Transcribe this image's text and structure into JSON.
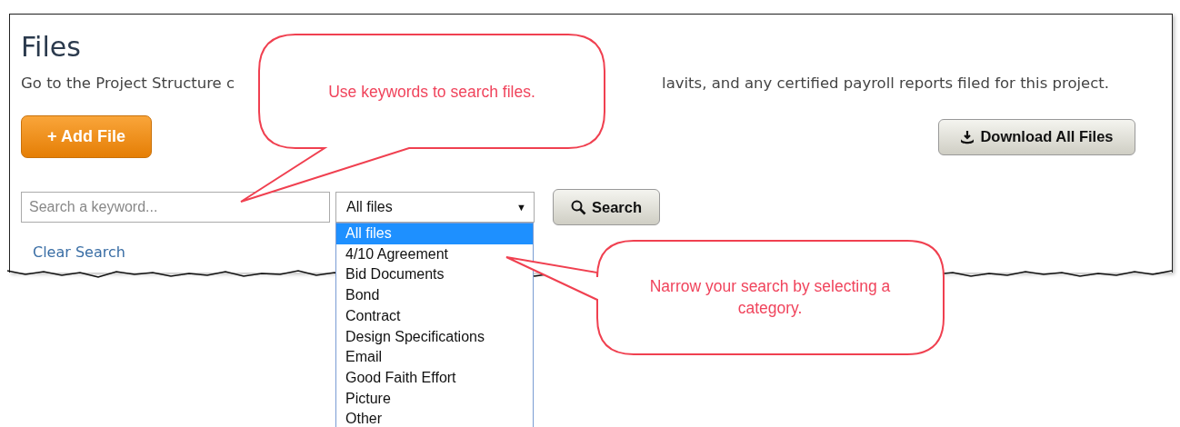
{
  "page": {
    "title": "Files",
    "description_left": "Go to the Project Structure c",
    "description_right": "lavits, and any certified payroll reports filed for this project."
  },
  "buttons": {
    "add_file": "+ Add File",
    "download_all": "Download All Files",
    "search": "Search"
  },
  "search": {
    "placeholder": "Search a keyword...",
    "clear_link": "Clear Search"
  },
  "category_select": {
    "value": "All files",
    "arrow": "▼",
    "expanded": true,
    "options": [
      {
        "label": "All files",
        "selected": true
      },
      {
        "label": "4/10 Agreement",
        "selected": false
      },
      {
        "label": "Bid Documents",
        "selected": false
      },
      {
        "label": "Bond",
        "selected": false
      },
      {
        "label": "Contract",
        "selected": false
      },
      {
        "label": "Design Specifications",
        "selected": false
      },
      {
        "label": "Email",
        "selected": false
      },
      {
        "label": "Good Faith Effort",
        "selected": false
      },
      {
        "label": "Picture",
        "selected": false
      },
      {
        "label": "Other",
        "selected": false
      }
    ]
  },
  "callouts": [
    {
      "text": "Use keywords to search files."
    },
    {
      "text": "Narrow your search by selecting a category."
    }
  ]
}
